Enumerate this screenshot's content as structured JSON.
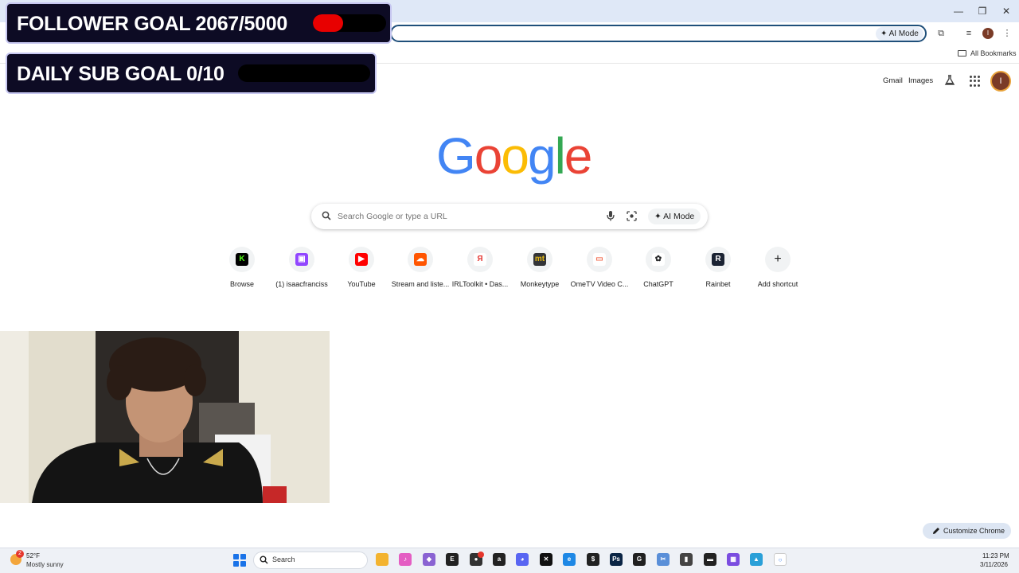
{
  "browser": {
    "omnibox_ai_label": "AI Mode",
    "bookmarks_label": "All Bookmarks",
    "avatar_initial": "I"
  },
  "ntp": {
    "header_links": [
      "Gmail",
      "Images"
    ],
    "avatar_initial": "I",
    "logo_letters": [
      {
        "char": "G",
        "color": "#4285F4"
      },
      {
        "char": "o",
        "color": "#EA4335"
      },
      {
        "char": "o",
        "color": "#FBBC05"
      },
      {
        "char": "g",
        "color": "#4285F4"
      },
      {
        "char": "l",
        "color": "#34A853"
      },
      {
        "char": "e",
        "color": "#EA4335"
      }
    ],
    "search": {
      "placeholder": "Search Google or type a URL",
      "ai_mode_label": "AI Mode"
    },
    "shortcuts": [
      {
        "label": "Browse",
        "icon": "kick-icon",
        "bg": "#000000",
        "fg": "#53fc18",
        "glyph": "K"
      },
      {
        "label": "(1) isaacfranciss",
        "icon": "twitch-icon",
        "bg": "#9146ff",
        "fg": "#ffffff",
        "glyph": "▣"
      },
      {
        "label": "YouTube",
        "icon": "youtube-icon",
        "bg": "#ff0000",
        "fg": "#ffffff",
        "glyph": "▶"
      },
      {
        "label": "Stream and liste...",
        "icon": "soundcloud-icon",
        "bg": "#ff5500",
        "fg": "#ffffff",
        "glyph": "☁"
      },
      {
        "label": "IRLToolkit • Das...",
        "icon": "irltoolkit-icon",
        "bg": "#ffffff",
        "fg": "#e53935",
        "glyph": "Я"
      },
      {
        "label": "Monkeytype",
        "icon": "monkeytype-icon",
        "bg": "#323437",
        "fg": "#e2b714",
        "glyph": "mt"
      },
      {
        "label": "OmeTV Video C...",
        "icon": "ometv-icon",
        "bg": "#ffffff",
        "fg": "#f26c4f",
        "glyph": "▭"
      },
      {
        "label": "ChatGPT",
        "icon": "chatgpt-icon",
        "bg": "#ffffff",
        "fg": "#202123",
        "glyph": "✿"
      },
      {
        "label": "Rainbet",
        "icon": "rainbet-icon",
        "bg": "#1b2333",
        "fg": "#ffffff",
        "glyph": "R"
      },
      {
        "label": "Add shortcut",
        "icon": "plus-icon",
        "bg": "transparent",
        "fg": "#1f1f1f",
        "glyph": "+"
      }
    ],
    "customize_label": "Customize Chrome"
  },
  "overlays": {
    "follower_goal": {
      "text": "FOLLOWER GOAL 2067/5000",
      "current": 2067,
      "target": 5000
    },
    "sub_goal": {
      "text": "DAILY SUB GOAL 0/10",
      "current": 0,
      "target": 10
    }
  },
  "taskbar": {
    "weather_temp": "52°F",
    "weather_desc": "Mostly sunny",
    "weather_badge": "2",
    "search_label": "Search",
    "time": "11:23 PM",
    "date": "3/11/2026",
    "apps": [
      {
        "name": "file-explorer-icon",
        "color": "#f3b32f",
        "glyph": ""
      },
      {
        "name": "itunes-icon",
        "color": "#e45ec3",
        "glyph": "♪"
      },
      {
        "name": "game-controller-icon",
        "color": "#8a63d2",
        "glyph": "◆"
      },
      {
        "name": "epic-games-icon",
        "color": "#222222",
        "glyph": "E"
      },
      {
        "name": "app-icon",
        "color": "#333333",
        "glyph": "●"
      },
      {
        "name": "arc-icon",
        "color": "#222222",
        "glyph": "a"
      },
      {
        "name": "discord-icon",
        "color": "#5865f2",
        "glyph": "◕"
      },
      {
        "name": "capcut-icon",
        "color": "#111111",
        "glyph": "✕"
      },
      {
        "name": "edge-icon",
        "color": "#1e88e5",
        "glyph": "e"
      },
      {
        "name": "cash-app-icon",
        "color": "#222222",
        "glyph": "$"
      },
      {
        "name": "photoshop-icon",
        "color": "#0b2545",
        "glyph": "Ps"
      },
      {
        "name": "g-icon",
        "color": "#202020",
        "glyph": "G"
      },
      {
        "name": "snipping-icon",
        "color": "#5a8fd8",
        "glyph": "✂"
      },
      {
        "name": "mic-icon",
        "color": "#444444",
        "glyph": "▮"
      },
      {
        "name": "terminal-icon",
        "color": "#222222",
        "glyph": "▬"
      },
      {
        "name": "grid-app-icon",
        "color": "#7b4de0",
        "glyph": "▦"
      },
      {
        "name": "photos-icon",
        "color": "#2aa0d8",
        "glyph": "▲"
      },
      {
        "name": "chrome-icon",
        "color": "#ffffff",
        "glyph": "○"
      }
    ]
  }
}
